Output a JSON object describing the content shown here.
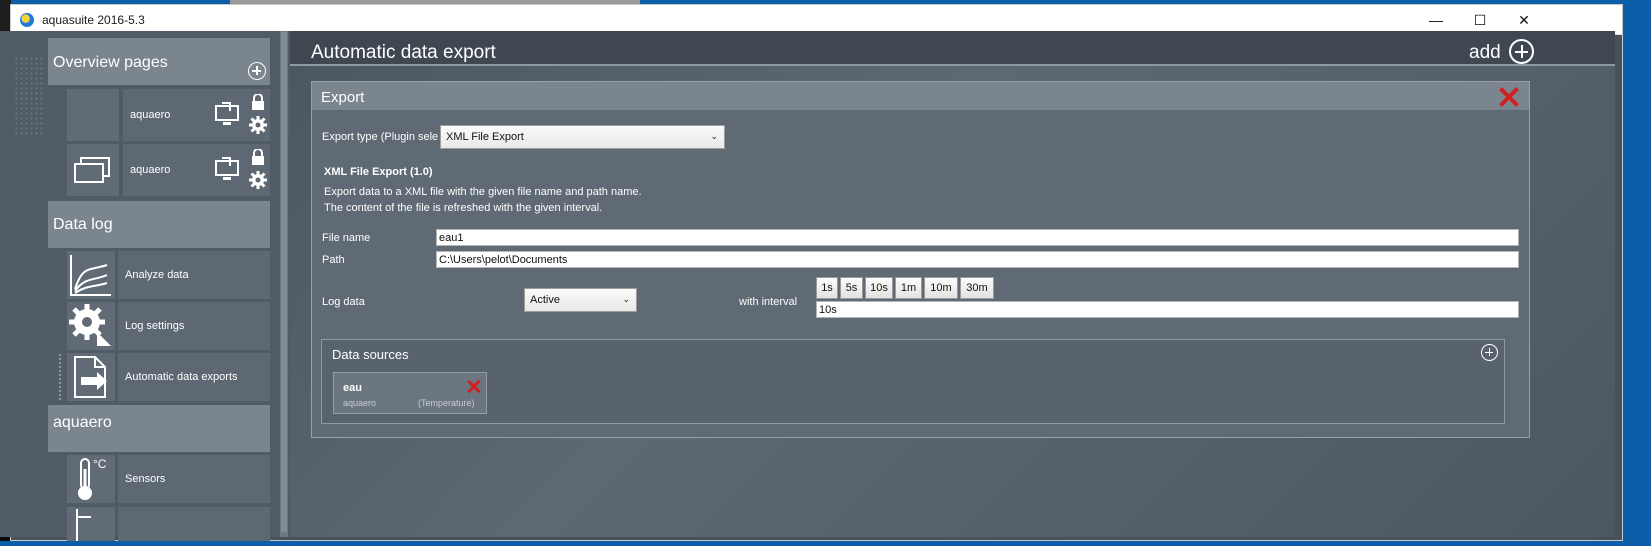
{
  "window": {
    "title": "aquasuite 2016-5.3",
    "minimize": "—",
    "maximize": "☐",
    "close": "✕"
  },
  "sidebar": {
    "sections": [
      {
        "label": "Overview pages",
        "items": [
          {
            "label": "aquaero",
            "icon": "blank-page-icon"
          },
          {
            "label": "aquaero",
            "icon": "stacked-pages-icon"
          }
        ]
      },
      {
        "label": "Data log",
        "items": [
          {
            "label": "Analyze data",
            "icon": "chart-curves-icon"
          },
          {
            "label": "Log settings",
            "icon": "gear-icon"
          },
          {
            "label": "Automatic data exports",
            "icon": "export-file-icon"
          }
        ]
      },
      {
        "label": "aquaero",
        "items": [
          {
            "label": "Sensors",
            "icon": "thermometer-icon",
            "unit": "°C"
          }
        ]
      }
    ]
  },
  "main": {
    "title": "Automatic data export",
    "add_label": "add",
    "export": {
      "title": "Export",
      "type_label": "Export type (Plugin sele",
      "type_value": "XML File Export",
      "plugin_name": "XML File Export (1.0)",
      "description_line1": "Export data to a XML file with the given file name and path name.",
      "description_line2": "The content of the file is refreshed with the given interval.",
      "file_name_label": "File name",
      "file_name_value": "eau1",
      "path_label": "Path",
      "path_value": "C:\\Users\\pelot\\Documents",
      "log_data_label": "Log data",
      "log_data_value": "Active",
      "interval_label": "with interval",
      "interval_buttons": [
        "1s",
        "5s",
        "10s",
        "1m",
        "10m",
        "30m"
      ],
      "interval_value": "10s",
      "data_sources_title": "Data sources",
      "sources": [
        {
          "name": "eau",
          "device": "aquaero",
          "type": "(Temperature)"
        }
      ]
    }
  }
}
